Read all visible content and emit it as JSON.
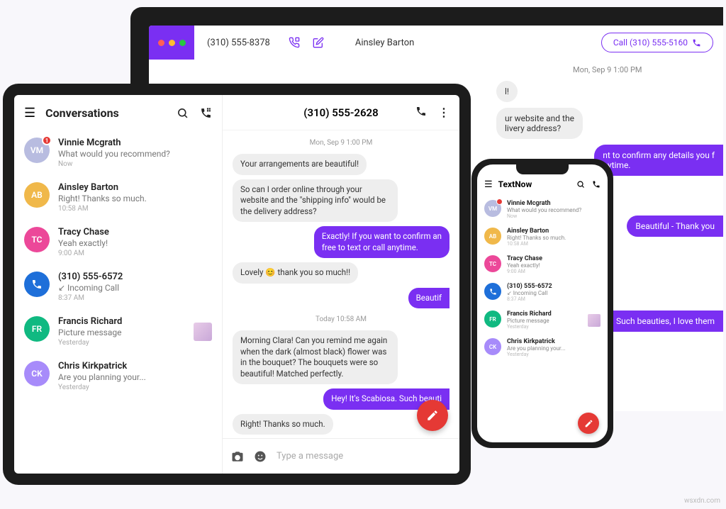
{
  "watermark": "wsxdn.com",
  "laptop": {
    "phone_number": "(310) 555-8378",
    "contact_name": "Ainsley Barton",
    "call_button": "Call (310) 555-5160",
    "timestamp": "Mon, Sep 9 1:00 PM",
    "msg_in_1": "l!",
    "msg_in_2": "ur website and the\nlivery address?",
    "msg_out_1": "nt to confirm any details you f\nnytime.",
    "msg_out_2": "Beautiful - Thank you",
    "msg_out_3": "n. Such beauties, I love them"
  },
  "tablet": {
    "side_title": "Conversations",
    "conversations": [
      {
        "initials": "VM",
        "color": "#b8bce0",
        "name": "Vinnie Mcgrath",
        "preview": "What would you recommend?",
        "time": "Now",
        "badge": "1"
      },
      {
        "initials": "AB",
        "color": "#f0b84a",
        "name": "Ainsley Barton",
        "preview": "Right! Thanks so much.",
        "time": "10:58 AM"
      },
      {
        "initials": "TC",
        "color": "#ec4899",
        "name": "Tracy Chase",
        "preview": "Yeah exactly!",
        "time": "9:00 AM"
      },
      {
        "initials": "",
        "color": "#1e6fd9",
        "name": "(310) 555-6572",
        "preview": "↙ Incoming Call",
        "time": "8:37 AM",
        "icon": "phone"
      },
      {
        "initials": "FR",
        "color": "#10b981",
        "name": "Francis Richard",
        "preview": "Picture message",
        "time": "Yesterday",
        "thumb": true
      },
      {
        "initials": "CK",
        "color": "#a78bfa",
        "name": "Chris Kirkpatrick",
        "preview": "Are you planning your...",
        "time": "Yesterday"
      }
    ],
    "chat_title": "(310) 555-2628",
    "stamp1": "Mon, Sep 9 1:00 PM",
    "m1": "Your arrangements are beautiful!",
    "m2": "So can I order online through your website and the \"shipping info\" would be the delivery address?",
    "m3": "Exactly! If you want to confirm an\nfree to text or call anytime.",
    "m4": "Lovely 😊 thank you so much!!",
    "m5": "Beautif",
    "stamp2": "Today 10:58 AM",
    "m6": "Morning Clara! Can you remind me again when the dark (almost black) flower was in the bouquet? The bouquets were so beautiful! Matched perfectly.",
    "m7": "Hey! It's Scabiosa. Such beauti",
    "m8": "Right! Thanks so much.",
    "compose_placeholder": "Type a message"
  },
  "phone": {
    "title": "TextNow",
    "conversations": [
      {
        "initials": "VM",
        "color": "#b8bce0",
        "name": "Vinnie Mcgrath",
        "preview": "What would you recommend?",
        "time": "Now",
        "badge": true
      },
      {
        "initials": "AB",
        "color": "#f0b84a",
        "name": "Ainsley Barton",
        "preview": "Right! Thanks so much.",
        "time": "10:58 AM"
      },
      {
        "initials": "TC",
        "color": "#ec4899",
        "name": "Tracy Chase",
        "preview": "Yeah exactly!",
        "time": "9:00 AM"
      },
      {
        "initials": "",
        "color": "#1e6fd9",
        "name": "(310) 555-6572",
        "preview": "↙ Incoming Call",
        "time": "8:37 AM",
        "icon": "phone"
      },
      {
        "initials": "FR",
        "color": "#10b981",
        "name": "Francis Richard",
        "preview": "Picture message",
        "time": "Yesterday",
        "thumb": true
      },
      {
        "initials": "CK",
        "color": "#a78bfa",
        "name": "Chris Kirkpatrick",
        "preview": "Are you planning your...",
        "time": "Yesterday"
      }
    ]
  }
}
